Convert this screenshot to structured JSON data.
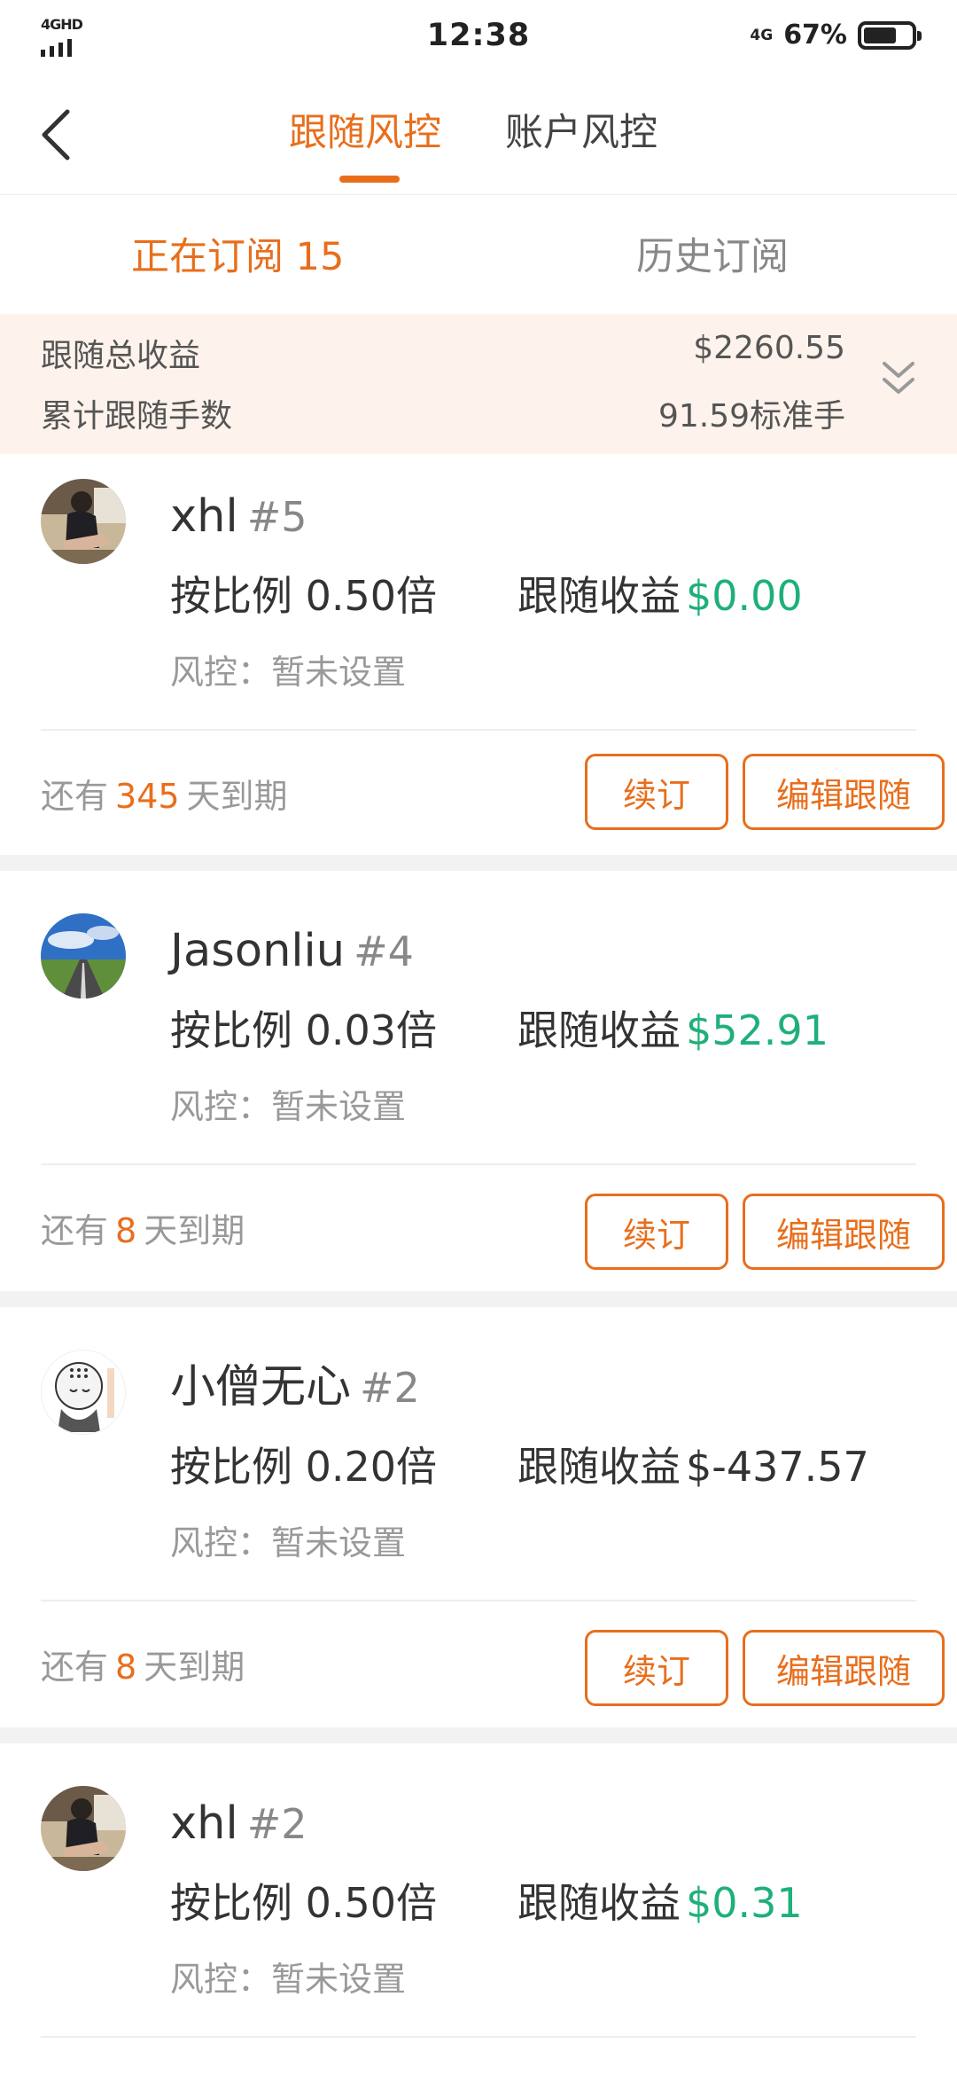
{
  "status_bar": {
    "network": "4GHD",
    "time": "12:38",
    "network_right": "4G",
    "battery": "67%"
  },
  "header": {
    "tabs": [
      {
        "label": "跟随风控",
        "active": true
      },
      {
        "label": "账户风控",
        "active": false
      }
    ]
  },
  "subtabs": {
    "current": "正在订阅 15",
    "history": "历史订阅"
  },
  "summary": {
    "total_profit_label": "跟随总收益",
    "total_profit_value": "$2260.55",
    "total_lots_label": "累计跟随手数",
    "total_lots_value": "91.59标准手"
  },
  "subscriptions": [
    {
      "name": "xhl",
      "rank": "#5",
      "ratio": "按比例 0.50倍",
      "profit_label": "跟随收益",
      "profit_value": "$0.00",
      "risk": "风控：暂未设置",
      "expire_prefix": "还有",
      "expire_days": "345",
      "expire_suffix": "天到期",
      "renew_label": "续订",
      "edit_label": "编辑跟随"
    },
    {
      "name": "Jasonliu",
      "rank": "#4",
      "ratio": "按比例 0.03倍",
      "profit_label": "跟随收益",
      "profit_value": "$52.91",
      "risk": "风控：暂未设置",
      "expire_prefix": "还有",
      "expire_days": "8",
      "expire_suffix": "天到期",
      "renew_label": "续订",
      "edit_label": "编辑跟随"
    },
    {
      "name": "小僧无心",
      "rank": "#2",
      "ratio": "按比例 0.20倍",
      "profit_label": "跟随收益",
      "profit_value": "$-437.57",
      "risk": "风控：暂未设置",
      "expire_prefix": "还有",
      "expire_days": "8",
      "expire_suffix": "天到期",
      "renew_label": "续订",
      "edit_label": "编辑跟随"
    },
    {
      "name": "xhl",
      "rank": "#2",
      "ratio": "按比例 0.50倍",
      "profit_label": "跟随收益",
      "profit_value": "$0.31",
      "risk": "风控：暂未设置"
    }
  ],
  "colors": {
    "accent": "#e86e1c",
    "positive": "#1fb07a",
    "summary_bg": "#fdf3ec"
  },
  "icons": {
    "back": "chevron-left-icon",
    "expand": "double-chevron-down-icon"
  }
}
